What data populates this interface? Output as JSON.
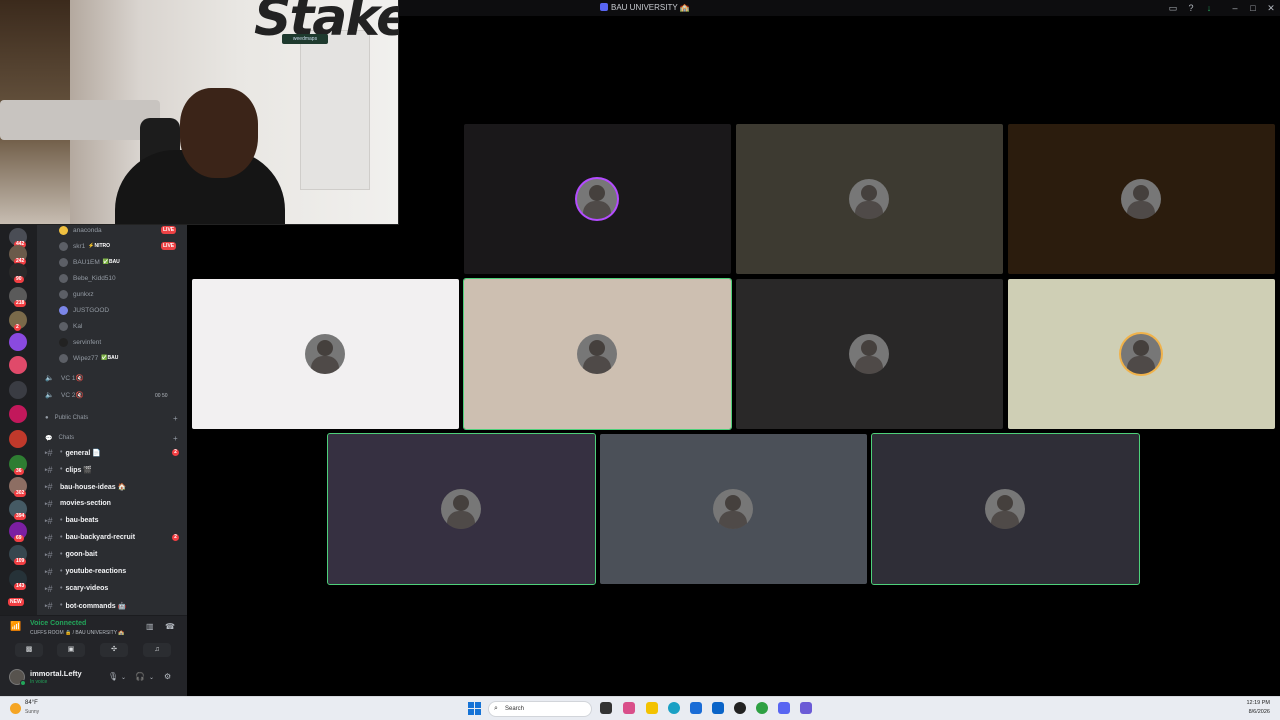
{
  "window": {
    "title": "BAU UNIVERSITY 🏫"
  },
  "overlay": {
    "brand_text": "Stake",
    "sign_text": "weedmaps"
  },
  "servers": [
    {
      "badge": "442"
    },
    {
      "badge": "242"
    },
    {
      "badge": "90"
    },
    {
      "badge": "218"
    },
    {
      "badge": "2"
    },
    {
      "badge": ""
    },
    {
      "badge": ""
    },
    {
      "badge": ""
    },
    {
      "badge": ""
    },
    {
      "badge": ""
    },
    {
      "badge": "36"
    },
    {
      "badge": "302"
    },
    {
      "badge": "394"
    },
    {
      "badge": "69"
    },
    {
      "badge": "109"
    },
    {
      "badge": "143"
    }
  ],
  "servers_new_label": "NEW",
  "voice_users": [
    {
      "name": "anaconda",
      "tag": "",
      "live": "LIVE"
    },
    {
      "name": "skr1",
      "tag": "⚡NITRO",
      "live": "LIVE"
    },
    {
      "name": "BAU1EM",
      "tag": "✅BAU",
      "live": ""
    },
    {
      "name": "Bebe_Kidd510",
      "tag": "",
      "live": ""
    },
    {
      "name": "gunkxz",
      "tag": "",
      "live": ""
    },
    {
      "name": "JUSTGOOD",
      "tag": "",
      "live": ""
    },
    {
      "name": "Kal",
      "tag": "",
      "live": ""
    },
    {
      "name": "servinfent",
      "tag": "",
      "live": ""
    },
    {
      "name": "Wipez77",
      "tag": "✅BAU",
      "live": ""
    }
  ],
  "voice_channels": [
    {
      "name": "VC 1🔇"
    },
    {
      "name": "VC 2🔇"
    }
  ],
  "vc2_counts": "00 50",
  "categories": [
    {
      "name": "Public Chats"
    },
    {
      "name": "Chats"
    }
  ],
  "channels": [
    {
      "name": "general 📄",
      "dot": "•",
      "badge": "2"
    },
    {
      "name": "clips 🎬",
      "dot": "•",
      "badge": ""
    },
    {
      "name": "bau-house-ideas 🏠",
      "dot": "",
      "badge": ""
    },
    {
      "name": "movies-section",
      "dot": "",
      "badge": ""
    },
    {
      "name": "bau-beats",
      "dot": "•",
      "badge": ""
    },
    {
      "name": "bau-backyard-recruit",
      "dot": "•",
      "badge": "2"
    },
    {
      "name": "goon-bait",
      "dot": "•",
      "badge": ""
    },
    {
      "name": "youtube-reactions",
      "dot": "•",
      "badge": ""
    },
    {
      "name": "scary-videos",
      "dot": "•",
      "badge": ""
    },
    {
      "name": "bot-commands 🤖",
      "dot": "•",
      "badge": ""
    }
  ],
  "voice_panel": {
    "status": "Voice Connected",
    "subtitle": "CUFFS ROOM 🔒 / BAU UNIVERSITY 🏫"
  },
  "user": {
    "name": "immortal.Lefty",
    "status": "In voice"
  },
  "tiles": [
    {
      "bg": "#1a181a",
      "ring": "#b44cff"
    },
    {
      "bg": "#3d3a31",
      "ring": ""
    },
    {
      "bg": "#2b1c0d",
      "ring": ""
    },
    {
      "bg": "#f2f0f1",
      "ring": ""
    },
    {
      "bg": "#cdbfb1",
      "ring": ""
    },
    {
      "bg": "#292828",
      "ring": ""
    },
    {
      "bg": "#cfcfb5",
      "ring": "#f0b24a"
    },
    {
      "bg": "#363041",
      "ring": ""
    },
    {
      "bg": "#4b5058",
      "ring": ""
    },
    {
      "bg": "#2f2e37",
      "ring": ""
    }
  ],
  "taskbar": {
    "temp": "84°F",
    "condition": "Sunny",
    "search_placeholder": "Search",
    "time": "12:19 PM",
    "date": "8/6/2026"
  }
}
